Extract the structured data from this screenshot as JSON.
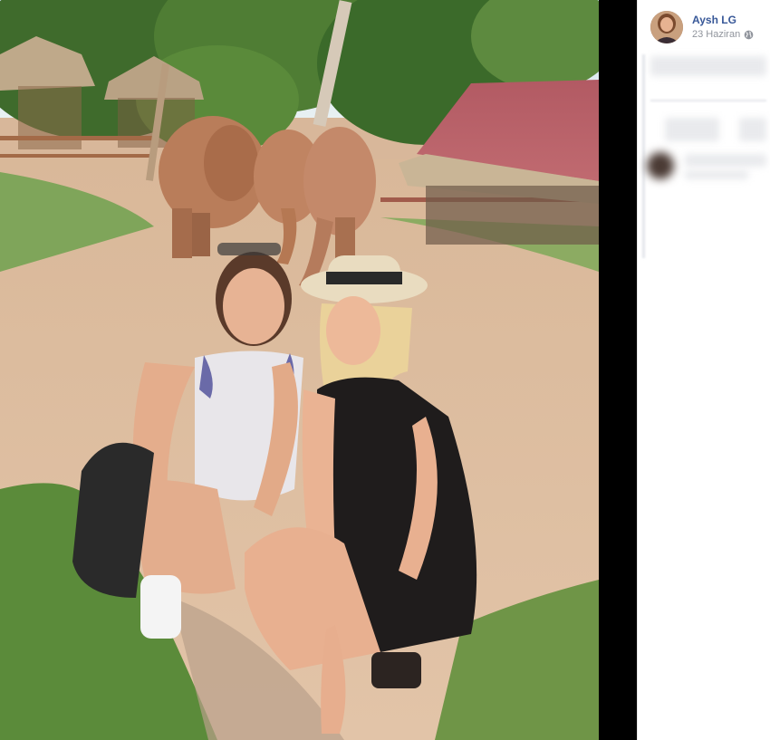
{
  "photo": {
    "description_icon": "photo-image"
  },
  "post": {
    "author_name": "Aysh LG",
    "date": "23 Haziran",
    "privacy_icon": "globe-icon"
  },
  "colors": {
    "author_link": "#385898",
    "meta_text": "#90949c",
    "divider": "#000000"
  }
}
